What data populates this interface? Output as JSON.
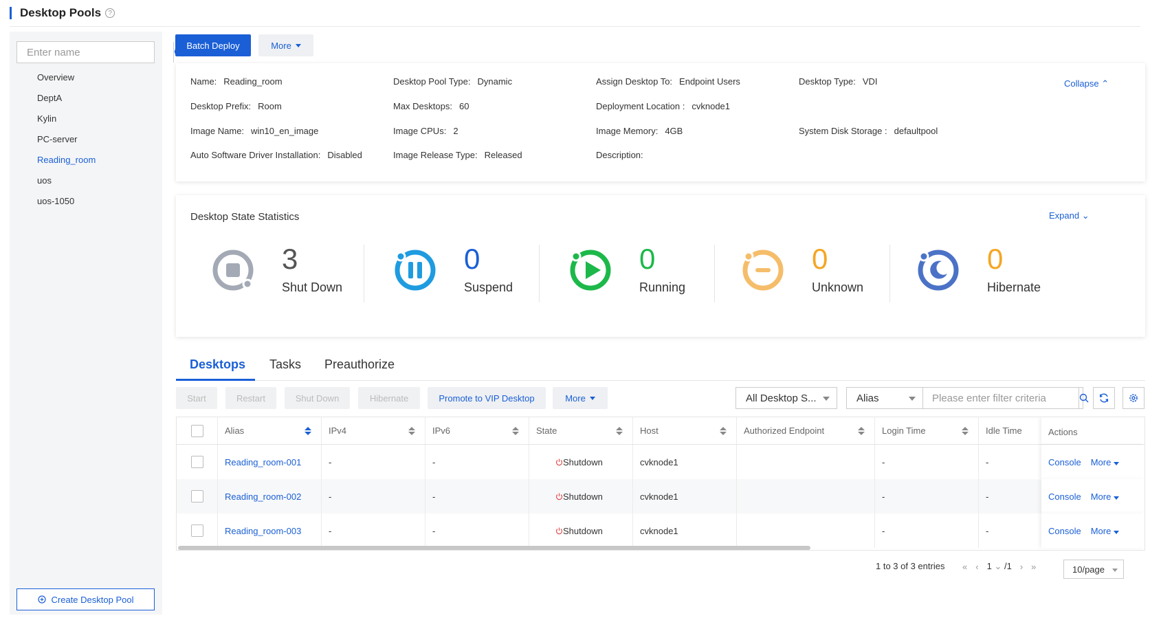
{
  "page": {
    "title": "Desktop Pools"
  },
  "sidebar": {
    "search_placeholder": "Enter name",
    "items": [
      {
        "label": "Overview"
      },
      {
        "label": "DeptA"
      },
      {
        "label": "Kylin"
      },
      {
        "label": "PC-server"
      },
      {
        "label": "Reading_room"
      },
      {
        "label": "uos"
      },
      {
        "label": "uos-1050"
      }
    ],
    "create_label": "Create Desktop Pool"
  },
  "toolbar": {
    "batch_deploy": "Batch Deploy",
    "more": "More"
  },
  "info": {
    "collapse": "Collapse",
    "name_k": "Name:",
    "name_v": "Reading_room",
    "type_k": "Desktop Pool Type:",
    "type_v": "Dynamic",
    "assign_k": "Assign Desktop To:",
    "assign_v": "Endpoint Users",
    "dtype_k": "Desktop Type:",
    "dtype_v": "VDI",
    "prefix_k": "Desktop Prefix:",
    "prefix_v": "Room",
    "max_k": "Max Desktops:",
    "max_v": "60",
    "loc_k": "Deployment Location :",
    "loc_v": "cvknode1",
    "img_k": "Image Name:",
    "img_v": "win10_en_image",
    "cpu_k": "Image CPUs:",
    "cpu_v": "2",
    "mem_k": "Image Memory:",
    "mem_v": "4GB",
    "disk_k": "System Disk Storage :",
    "disk_v": "defaultpool",
    "auto_k": "Auto Software Driver Installation:",
    "auto_v": "Disabled",
    "rel_k": "Image Release Type:",
    "rel_v": "Released",
    "desc_k": "Description:"
  },
  "stats": {
    "title": "Desktop State Statistics",
    "expand": "Expand",
    "items": [
      {
        "num": "3",
        "label": "Shut Down",
        "color": "#a3aab5"
      },
      {
        "num": "0",
        "label": "Suspend",
        "color": "#1f9be0"
      },
      {
        "num": "0",
        "label": "Running",
        "color": "#1db84a"
      },
      {
        "num": "0",
        "label": "Unknown",
        "color": "#f5bd6a"
      },
      {
        "num": "0",
        "label": "Hibernate",
        "color": "#4b72c6"
      }
    ]
  },
  "tabs": [
    {
      "label": "Desktops"
    },
    {
      "label": "Tasks"
    },
    {
      "label": "Preauthorize"
    }
  ],
  "actions": {
    "start": "Start",
    "restart": "Restart",
    "shutdown": "Shut Down",
    "hibernate": "Hibernate",
    "promote": "Promote to VIP Desktop",
    "more": "More",
    "state_filter": "All Desktop S...",
    "field": "Alias",
    "filter_placeholder": "Please enter filter criteria"
  },
  "table": {
    "headers": [
      "Alias",
      "IPv4",
      "IPv6",
      "State",
      "Host",
      "Authorized Endpoint",
      "Login Time",
      "Idle Time",
      "Actions"
    ],
    "rows": [
      {
        "alias": "Reading_room-001",
        "ipv4": "-",
        "ipv6": "-",
        "state": "Shutdown",
        "host": "cvknode1",
        "endpoint": "",
        "login": "-",
        "idle": "-",
        "console": "Console",
        "more": "More"
      },
      {
        "alias": "Reading_room-002",
        "ipv4": "-",
        "ipv6": "-",
        "state": "Shutdown",
        "host": "cvknode1",
        "endpoint": "",
        "login": "-",
        "idle": "-",
        "console": "Console",
        "more": "More"
      },
      {
        "alias": "Reading_room-003",
        "ipv4": "-",
        "ipv6": "-",
        "state": "Shutdown",
        "host": "cvknode1",
        "endpoint": "",
        "login": "-",
        "idle": "-",
        "console": "Console",
        "more": "More"
      }
    ]
  },
  "pagination": {
    "summary": "1 to 3 of 3 entries",
    "page": "1",
    "total": "/1",
    "per_page": "10/page"
  }
}
